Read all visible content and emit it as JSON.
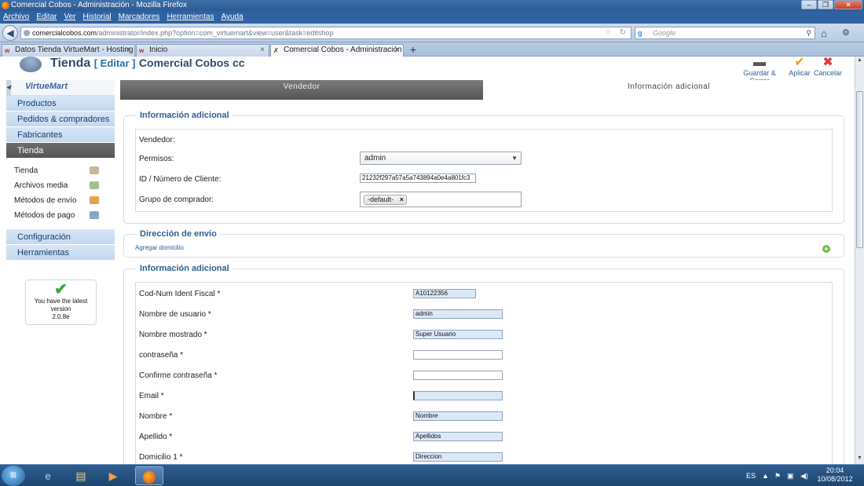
{
  "window": {
    "title": "Comercial Cobos - Administración - Mozilla Firefox",
    "buttons": [
      "–",
      "❐",
      "✕"
    ]
  },
  "menu": [
    "Archivo",
    "Editar",
    "Ver",
    "Historial",
    "Marcadores",
    "Herramientas",
    "Ayuda"
  ],
  "nav": {
    "url_domain": "comercialcobos.com",
    "url_path": "/administrator/index.php?option=com_virtuemart&view=user&task=editshop",
    "search_placeholder": "Google"
  },
  "tabs": [
    {
      "label": "Datos Tienda VirtueMart - Hosting Jo...",
      "active": false
    },
    {
      "label": "Inicio",
      "active": false
    },
    {
      "label": "Comercial Cobos - Administración",
      "active": true
    }
  ],
  "header": {
    "title": "Tienda",
    "edit": "[ Editar ]",
    "subtitle": "Comercial Cobos cc"
  },
  "toolbar": {
    "save_close": "Guardar & Cerrar",
    "apply": "Aplicar",
    "cancel": "Cancelar"
  },
  "sidebar": {
    "logo": "VirtueMart",
    "items_top": [
      "Productos",
      "Pedidos & compradores",
      "Fabricantes"
    ],
    "active": "Tienda",
    "subitems": [
      "Tienda",
      "Archivos media",
      "Métodos de envío",
      "Métodos de pago"
    ],
    "items_bottom": [
      "Configuración",
      "Herramientas"
    ],
    "version_line1": "You have the latest",
    "version_line2": "version",
    "version_number": "2.0.8e"
  },
  "main_tabs": [
    "Vendedor",
    "Información adicional"
  ],
  "section1": {
    "legend": "Información adicional",
    "vendor_label": "Vendedor:",
    "permissions_label": "Permisos:",
    "permissions_value": "admin",
    "client_id_label": "ID / Número de Cliente:",
    "client_id_value": "21232f297a57a5a743894a0e4a801fc3",
    "group_label": "Grupo de comprador:",
    "group_chip": "-default-"
  },
  "section2": {
    "legend": "Dirección de envío",
    "add_link": "Agregar domicilio"
  },
  "section3": {
    "legend": "Información adicional",
    "fields": [
      {
        "label": "Cod-Num Ident Fiscal *",
        "value": ""
      },
      {
        "label": "Nombre de usuario *",
        "value": "admin"
      },
      {
        "label": "Nombre mostrado *",
        "value": "Super Usuario"
      },
      {
        "label": "contraseña *",
        "value": ""
      },
      {
        "label": "Confirme contraseña *",
        "value": ""
      },
      {
        "label": "Email *",
        "value": ""
      },
      {
        "label": "Nombre *",
        "value": "Nombre"
      },
      {
        "label": "Apellido *",
        "value": "Apellidos"
      },
      {
        "label": "Domicilio 1 *",
        "value": "Direccion"
      }
    ],
    "tax_id_value": "A10122356"
  },
  "taskbar": {
    "lang": "ES",
    "time": "20:04",
    "date": "10/08/2012"
  },
  "colors": {
    "accent": "#2b5f94",
    "sidebar_active": "#555555",
    "input_highlight": "#dbe8f6"
  }
}
